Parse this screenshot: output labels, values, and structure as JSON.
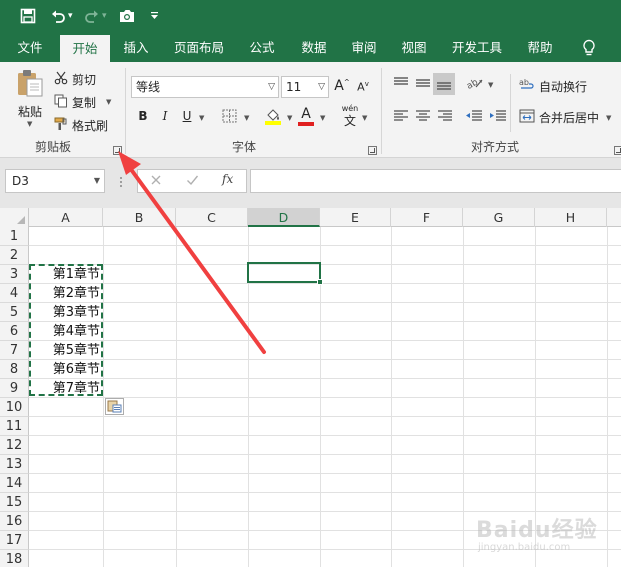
{
  "quick_access": {
    "save_icon": "save-icon",
    "undo_icon": "undo-icon",
    "redo_icon": "redo-icon",
    "camera_icon": "camera-icon"
  },
  "tabs": [
    {
      "label": "文件"
    },
    {
      "label": "开始"
    },
    {
      "label": "插入"
    },
    {
      "label": "页面布局"
    },
    {
      "label": "公式"
    },
    {
      "label": "数据"
    },
    {
      "label": "审阅"
    },
    {
      "label": "视图"
    },
    {
      "label": "开发工具"
    },
    {
      "label": "帮助"
    }
  ],
  "active_tab": "开始",
  "clipboard": {
    "paste": "粘贴",
    "cut": "剪切",
    "copy": "复制",
    "format_painter": "格式刷",
    "group": "剪贴板"
  },
  "font": {
    "name": "等线",
    "size": "11",
    "grow": "A",
    "shrink": "A",
    "bold": "B",
    "italic": "I",
    "underline": "U",
    "color_letter": "A",
    "pinyin_top": "wén",
    "pinyin_char": "文",
    "group": "字体"
  },
  "alignment": {
    "wrap": "自动换行",
    "merge": "合并后居中",
    "group": "对齐方式"
  },
  "formula_bar": {
    "name_box": "D3",
    "fx": "fx",
    "formula": ""
  },
  "columns": [
    "A",
    "B",
    "C",
    "D",
    "E",
    "F",
    "G",
    "H"
  ],
  "selected_column": "D",
  "rows": [
    "1",
    "2",
    "3",
    "4",
    "5",
    "6",
    "7",
    "8",
    "9",
    "10",
    "11",
    "12",
    "13",
    "14",
    "15",
    "16",
    "17",
    "18"
  ],
  "cells_A": [
    "",
    "",
    "第1章节",
    "第2章节",
    "第3章节",
    "第4章节",
    "第5章节",
    "第6章节",
    "第7章节",
    "",
    "",
    "",
    "",
    "",
    "",
    "",
    "",
    ""
  ],
  "watermark": {
    "brand": "Baidu经验",
    "url": "jingyan.baidu.com"
  },
  "colors": {
    "accent": "#217346",
    "annotation_arrow": "#f04040"
  }
}
